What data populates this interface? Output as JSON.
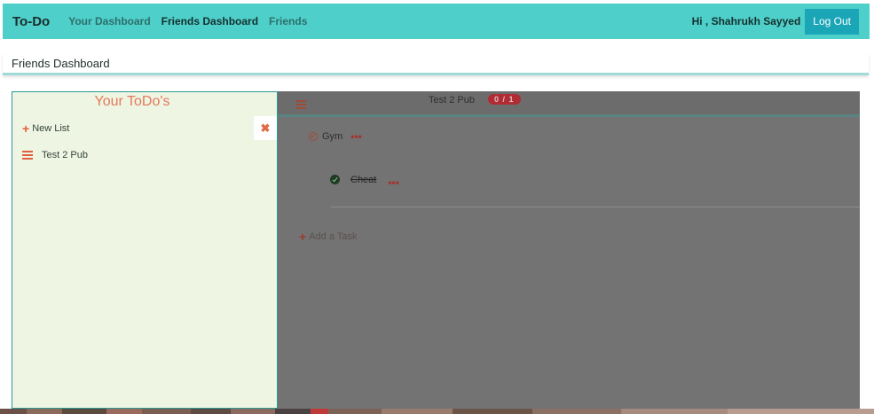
{
  "navbar": {
    "brand": "To-Do",
    "links": [
      "Your Dashboard",
      "Friends Dashboard",
      "Friends"
    ],
    "greeting": "Hi , Shahrukh Sayyed",
    "logout_label": "Log Out"
  },
  "page": {
    "title": "Friends Dashboard"
  },
  "sidebar": {
    "title": "Your ToDo's",
    "new_list_label": "New List",
    "close_glyph": "✖",
    "lists": [
      "Test 2 Pub"
    ]
  },
  "main": {
    "list_title": "Test 2 Pub",
    "badge": "0 / 1",
    "task": {
      "name": "Gym",
      "dots": "•••",
      "subtasks": [
        {
          "name": "Cheat",
          "done": true,
          "dots": "•••"
        }
      ]
    },
    "add_task_label": "Add a Task"
  },
  "colors": {
    "navbar": "#4ecfca",
    "logout_button": "#1aa6b7",
    "sidebar_bg": "#eef5e2",
    "sidebar_title": "#e27a5a",
    "accent": "#e0613f",
    "badge": "#b02b33"
  },
  "icons": {
    "new_list": "plus-icon",
    "close": "close-icon",
    "list": "menu-icon",
    "task_status": "circle-check-icon",
    "subtask_status": "check-circle-icon",
    "task_menu": "ellipsis-icon",
    "add_task": "plus-icon"
  }
}
